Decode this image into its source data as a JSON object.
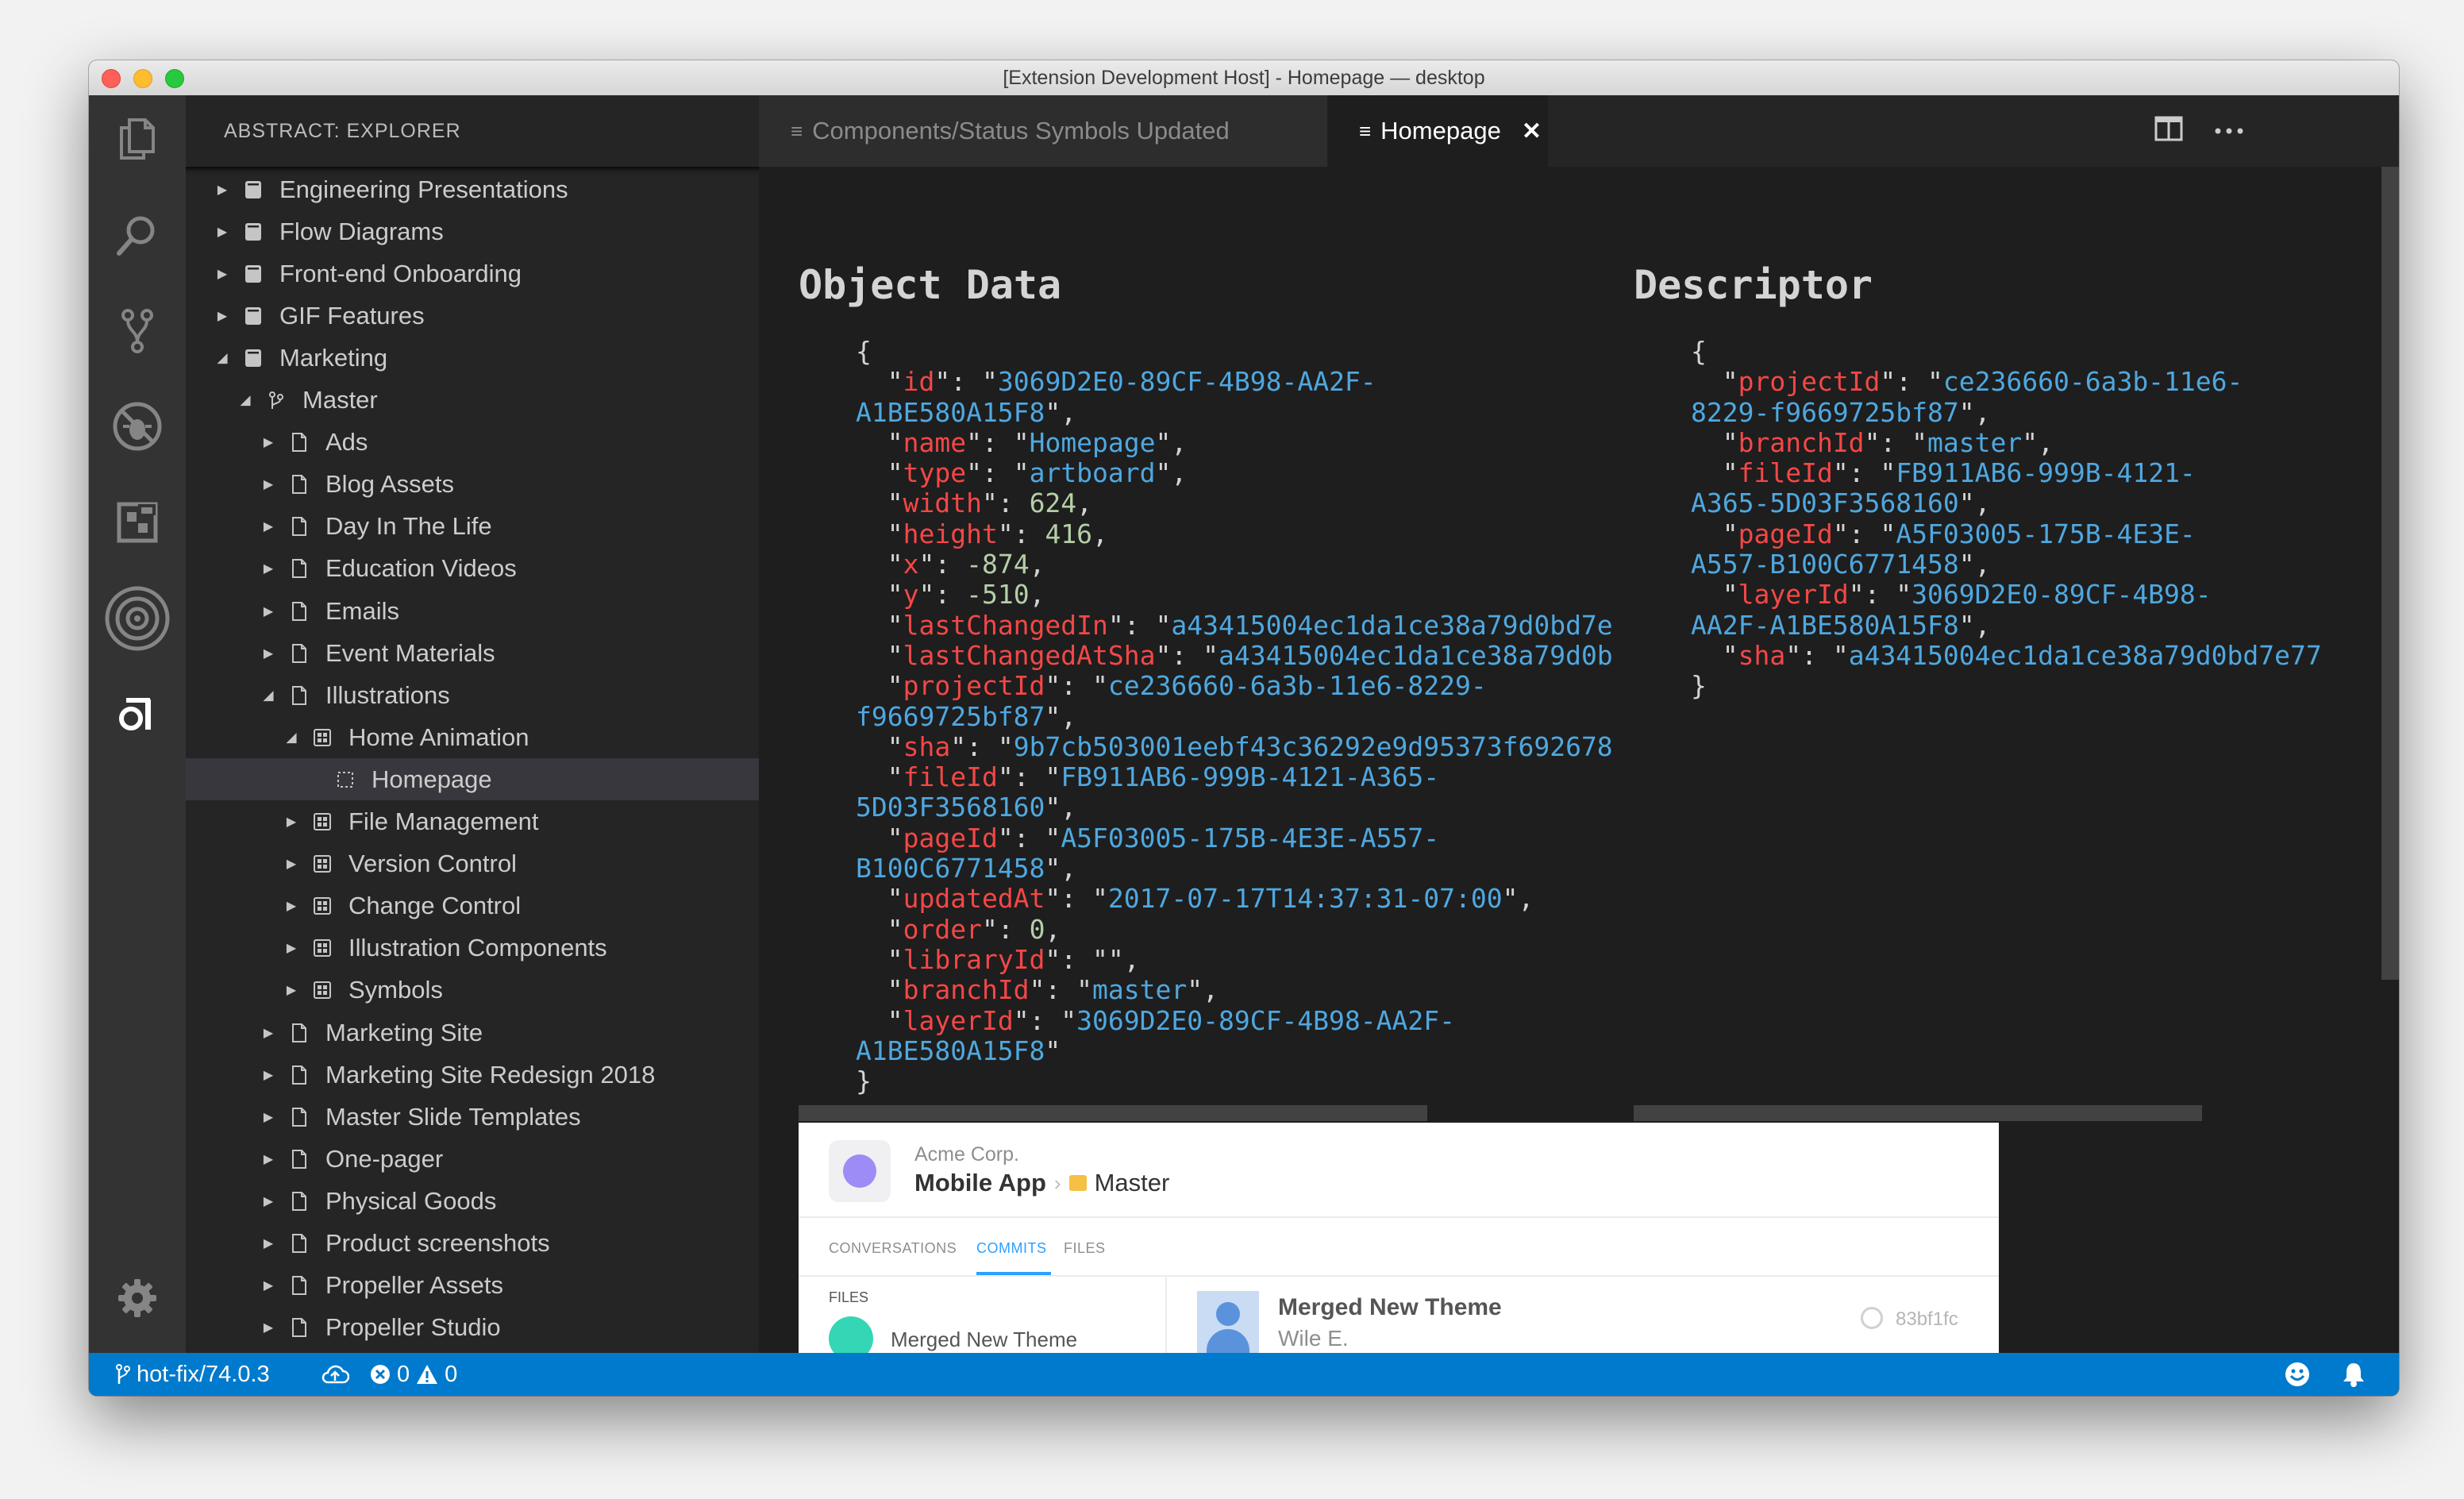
{
  "window": {
    "title": "[Extension Development Host] - Homepage — desktop",
    "traffic_lights": {
      "close": "#fe5f57",
      "minimize": "#febc2e",
      "zoom": "#28c840"
    }
  },
  "activity_bar": {
    "icons": [
      "files-icon",
      "search-icon",
      "source-control-icon",
      "debug-icon",
      "extensions-icon",
      "abstract-target-icon",
      "abstract-logo-icon",
      "settings-gear-icon"
    ]
  },
  "sidebar": {
    "title": "ABSTRACT: EXPLORER",
    "tree": [
      {
        "label": "Engineering Presentations",
        "depth": 0,
        "expanded": false,
        "icon": "project-icon"
      },
      {
        "label": "Flow Diagrams",
        "depth": 0,
        "expanded": false,
        "icon": "project-icon"
      },
      {
        "label": "Front-end Onboarding",
        "depth": 0,
        "expanded": false,
        "icon": "project-icon"
      },
      {
        "label": "GIF Features",
        "depth": 0,
        "expanded": false,
        "icon": "project-icon"
      },
      {
        "label": "Marketing",
        "depth": 0,
        "expanded": true,
        "icon": "project-icon"
      },
      {
        "label": "Master",
        "depth": 1,
        "expanded": true,
        "icon": "branch-icon"
      },
      {
        "label": "Ads",
        "depth": 2,
        "expanded": false,
        "icon": "file-icon"
      },
      {
        "label": "Blog Assets",
        "depth": 2,
        "expanded": false,
        "icon": "file-icon"
      },
      {
        "label": "Day In The Life",
        "depth": 2,
        "expanded": false,
        "icon": "file-icon"
      },
      {
        "label": "Education Videos",
        "depth": 2,
        "expanded": false,
        "icon": "file-icon"
      },
      {
        "label": "Emails",
        "depth": 2,
        "expanded": false,
        "icon": "file-icon"
      },
      {
        "label": "Event Materials",
        "depth": 2,
        "expanded": false,
        "icon": "file-icon"
      },
      {
        "label": "Illustrations",
        "depth": 2,
        "expanded": true,
        "icon": "file-icon"
      },
      {
        "label": "Home Animation",
        "depth": 3,
        "expanded": true,
        "icon": "page-icon"
      },
      {
        "label": "Homepage",
        "depth": 4,
        "leaf": true,
        "selected": true,
        "icon": "artboard-icon"
      },
      {
        "label": "File Management",
        "depth": 3,
        "expanded": false,
        "icon": "page-icon"
      },
      {
        "label": "Version Control",
        "depth": 3,
        "expanded": false,
        "icon": "page-icon"
      },
      {
        "label": "Change Control",
        "depth": 3,
        "expanded": false,
        "icon": "page-icon"
      },
      {
        "label": "Illustration Components",
        "depth": 3,
        "expanded": false,
        "icon": "page-icon"
      },
      {
        "label": "Symbols",
        "depth": 3,
        "expanded": false,
        "icon": "page-icon"
      },
      {
        "label": "Marketing Site",
        "depth": 2,
        "expanded": false,
        "icon": "file-icon"
      },
      {
        "label": "Marketing Site Redesign 2018",
        "depth": 2,
        "expanded": false,
        "icon": "file-icon"
      },
      {
        "label": "Master Slide Templates",
        "depth": 2,
        "expanded": false,
        "icon": "file-icon"
      },
      {
        "label": "One-pager",
        "depth": 2,
        "expanded": false,
        "icon": "file-icon"
      },
      {
        "label": "Physical Goods",
        "depth": 2,
        "expanded": false,
        "icon": "file-icon"
      },
      {
        "label": "Product screenshots",
        "depth": 2,
        "expanded": false,
        "icon": "file-icon"
      },
      {
        "label": "Propeller Assets",
        "depth": 2,
        "expanded": false,
        "icon": "file-icon"
      },
      {
        "label": "Propeller Studio",
        "depth": 2,
        "expanded": false,
        "icon": "file-icon"
      }
    ]
  },
  "tabs": [
    {
      "label": "Components/Status Symbols Updated",
      "active": false
    },
    {
      "label": "Homepage",
      "active": true
    }
  ],
  "editor": {
    "object_heading": "Object Data",
    "descriptor_heading": "Descriptor",
    "object_lines": [
      [
        [
          "p",
          "{"
        ]
      ],
      [
        [
          "p",
          "  \""
        ],
        [
          "k",
          "id"
        ],
        [
          "p",
          "\": \""
        ],
        [
          "s",
          "3069D2E0-89CF-4B98-AA2F-"
        ]
      ],
      [
        [
          "s",
          "A1BE580A15F8"
        ],
        [
          "p",
          "\","
        ]
      ],
      [
        [
          "p",
          "  \""
        ],
        [
          "k",
          "name"
        ],
        [
          "p",
          "\": \""
        ],
        [
          "s",
          "Homepage"
        ],
        [
          "p",
          "\","
        ]
      ],
      [
        [
          "p",
          "  \""
        ],
        [
          "k",
          "type"
        ],
        [
          "p",
          "\": \""
        ],
        [
          "s",
          "artboard"
        ],
        [
          "p",
          "\","
        ]
      ],
      [
        [
          "p",
          "  \""
        ],
        [
          "k",
          "width"
        ],
        [
          "p",
          "\": "
        ],
        [
          "n",
          "624"
        ],
        [
          "p",
          ","
        ]
      ],
      [
        [
          "p",
          "  \""
        ],
        [
          "k",
          "height"
        ],
        [
          "p",
          "\": "
        ],
        [
          "n",
          "416"
        ],
        [
          "p",
          ","
        ]
      ],
      [
        [
          "p",
          "  \""
        ],
        [
          "k",
          "x"
        ],
        [
          "p",
          "\": "
        ],
        [
          "n",
          "-874"
        ],
        [
          "p",
          ","
        ]
      ],
      [
        [
          "p",
          "  \""
        ],
        [
          "k",
          "y"
        ],
        [
          "p",
          "\": "
        ],
        [
          "n",
          "-510"
        ],
        [
          "p",
          ","
        ]
      ],
      [
        [
          "p",
          "  \""
        ],
        [
          "k",
          "lastChangedIn"
        ],
        [
          "p",
          "\": \""
        ],
        [
          "s",
          "a43415004ec1da1ce38a79d0bd7e"
        ]
      ],
      [
        [
          "p",
          "  \""
        ],
        [
          "k",
          "lastChangedAtSha"
        ],
        [
          "p",
          "\": \""
        ],
        [
          "s",
          "a43415004ec1da1ce38a79d0b"
        ]
      ],
      [
        [
          "p",
          "  \""
        ],
        [
          "k",
          "projectId"
        ],
        [
          "p",
          "\": \""
        ],
        [
          "s",
          "ce236660-6a3b-11e6-8229-"
        ]
      ],
      [
        [
          "s",
          "f9669725bf87"
        ],
        [
          "p",
          "\","
        ]
      ],
      [
        [
          "p",
          "  \""
        ],
        [
          "k",
          "sha"
        ],
        [
          "p",
          "\": \""
        ],
        [
          "s",
          "9b7cb503001eebf43c36292e9d95373f692678"
        ]
      ],
      [
        [
          "p",
          "  \""
        ],
        [
          "k",
          "fileId"
        ],
        [
          "p",
          "\": \""
        ],
        [
          "s",
          "FB911AB6-999B-4121-A365-"
        ]
      ],
      [
        [
          "s",
          "5D03F3568160"
        ],
        [
          "p",
          "\","
        ]
      ],
      [
        [
          "p",
          "  \""
        ],
        [
          "k",
          "pageId"
        ],
        [
          "p",
          "\": \""
        ],
        [
          "s",
          "A5F03005-175B-4E3E-A557-"
        ]
      ],
      [
        [
          "s",
          "B100C6771458"
        ],
        [
          "p",
          "\","
        ]
      ],
      [
        [
          "p",
          "  \""
        ],
        [
          "k",
          "updatedAt"
        ],
        [
          "p",
          "\": \""
        ],
        [
          "s",
          "2017-07-17T14:37:31-07:00"
        ],
        [
          "p",
          "\","
        ]
      ],
      [
        [
          "p",
          "  \""
        ],
        [
          "k",
          "order"
        ],
        [
          "p",
          "\": "
        ],
        [
          "n",
          "0"
        ],
        [
          "p",
          ","
        ]
      ],
      [
        [
          "p",
          "  \""
        ],
        [
          "k",
          "libraryId"
        ],
        [
          "p",
          "\": \"\","
        ]
      ],
      [
        [
          "p",
          "  \""
        ],
        [
          "k",
          "branchId"
        ],
        [
          "p",
          "\": \""
        ],
        [
          "s",
          "master"
        ],
        [
          "p",
          "\","
        ]
      ],
      [
        [
          "p",
          "  \""
        ],
        [
          "k",
          "layerId"
        ],
        [
          "p",
          "\": \""
        ],
        [
          "s",
          "3069D2E0-89CF-4B98-AA2F-"
        ]
      ],
      [
        [
          "s",
          "A1BE580A15F8"
        ],
        [
          "p",
          "\""
        ]
      ],
      [
        [
          "p",
          "}"
        ]
      ]
    ],
    "descriptor_lines": [
      [
        [
          "p",
          "{"
        ]
      ],
      [
        [
          "p",
          "  \""
        ],
        [
          "k",
          "projectId"
        ],
        [
          "p",
          "\": \""
        ],
        [
          "s",
          "ce236660-6a3b-11e6-"
        ]
      ],
      [
        [
          "s",
          "8229-f9669725bf87"
        ],
        [
          "p",
          "\","
        ]
      ],
      [
        [
          "p",
          "  \""
        ],
        [
          "k",
          "branchId"
        ],
        [
          "p",
          "\": \""
        ],
        [
          "s",
          "master"
        ],
        [
          "p",
          "\","
        ]
      ],
      [
        [
          "p",
          "  \""
        ],
        [
          "k",
          "fileId"
        ],
        [
          "p",
          "\": \""
        ],
        [
          "s",
          "FB911AB6-999B-4121-"
        ]
      ],
      [
        [
          "s",
          "A365-5D03F3568160"
        ],
        [
          "p",
          "\","
        ]
      ],
      [
        [
          "p",
          "  \""
        ],
        [
          "k",
          "pageId"
        ],
        [
          "p",
          "\": \""
        ],
        [
          "s",
          "A5F03005-175B-4E3E-"
        ]
      ],
      [
        [
          "s",
          "A557-B100C6771458"
        ],
        [
          "p",
          "\","
        ]
      ],
      [
        [
          "p",
          "  \""
        ],
        [
          "k",
          "layerId"
        ],
        [
          "p",
          "\": \""
        ],
        [
          "s",
          "3069D2E0-89CF-4B98-"
        ]
      ],
      [
        [
          "s",
          "AA2F-A1BE580A15F8"
        ],
        [
          "p",
          "\","
        ]
      ],
      [
        [
          "p",
          "  \""
        ],
        [
          "k",
          "sha"
        ],
        [
          "p",
          "\": \""
        ],
        [
          "s",
          "a43415004ec1da1ce38a79d0bd7e77"
        ]
      ],
      [
        [
          "p",
          "}"
        ]
      ]
    ]
  },
  "preview": {
    "org": "Acme Corp.",
    "project": "Mobile App",
    "branch": "Master",
    "tabs": [
      "CONVERSATIONS",
      "COMMITS",
      "FILES"
    ],
    "active_tab": "COMMITS",
    "files_label": "FILES",
    "file_item": "Merged New Theme",
    "commit_title": "Merged New Theme",
    "commit_author": "Wile E.",
    "commit_sha": "83bf1fc",
    "accent": "#2e9fff",
    "brand": "#9d8cf5",
    "success": "#34d6b6"
  },
  "statusbar": {
    "branch": "hot-fix/74.0.3",
    "errors": "0",
    "warnings": "0",
    "color": "#007acc"
  }
}
